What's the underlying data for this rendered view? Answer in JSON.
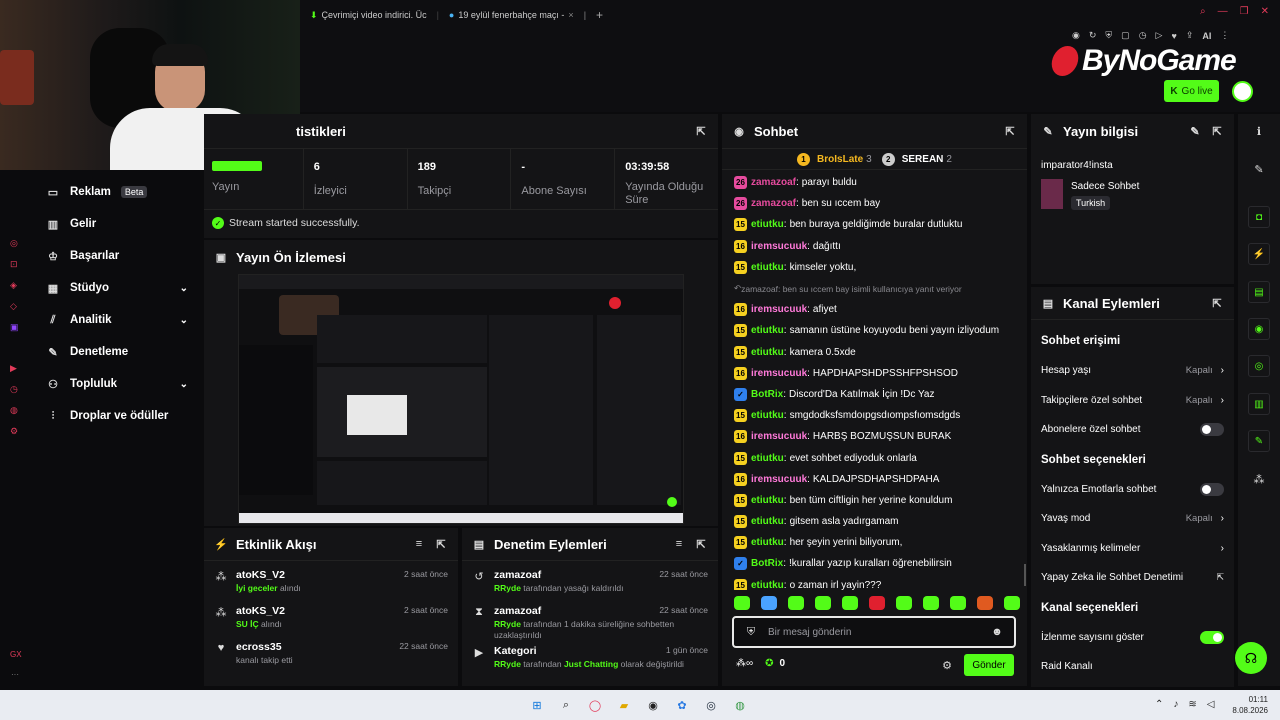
{
  "browser": {
    "tabs": [
      {
        "label": "Çevrimiçi video indirici. Üc"
      },
      {
        "label": "19 eylül fenerbahçe maçı -"
      }
    ],
    "new_tab": "+",
    "ai_label": "AI"
  },
  "brand": {
    "logo_text": "ByNoGame",
    "go_live": "Go live"
  },
  "stats": {
    "title": "Yayın İstatistikleri",
    "visible_title": "tistikleri",
    "cells": [
      {
        "value": "",
        "label": "Yayın"
      },
      {
        "value": "6",
        "label": "İzleyici"
      },
      {
        "value": "189",
        "label": "Takipçi"
      },
      {
        "value": "-",
        "label": "Abone Sayısı"
      },
      {
        "value": "03:39:58",
        "label": "Yayında Olduğu Süre"
      }
    ],
    "success": "Stream started successfully."
  },
  "preview": {
    "title": "Yayın Ön İzlemesi"
  },
  "sidebar": {
    "items": [
      {
        "label": "Reklam",
        "badge": "Beta",
        "icon": "tv-icon"
      },
      {
        "label": "Gelir",
        "icon": "chart-icon"
      },
      {
        "label": "Başarılar",
        "icon": "trophy-icon"
      },
      {
        "label": "Stüdyo",
        "icon": "studio-icon",
        "chevron": true
      },
      {
        "label": "Analitik",
        "icon": "analytics-icon",
        "chevron": true
      },
      {
        "label": "Denetleme",
        "icon": "wrench-icon"
      },
      {
        "label": "Topluluk",
        "icon": "community-icon",
        "chevron": true
      },
      {
        "label": "Droplar ve ödüller",
        "icon": "drop-icon"
      }
    ]
  },
  "activity": {
    "title": "Etkinlik Akışı",
    "items": [
      {
        "user": "atoKS_V2",
        "time": "2 saat önce",
        "item": "İyi geceler",
        "suffix": " alındı"
      },
      {
        "user": "atoKS_V2",
        "time": "2 saat önce",
        "item": "SU İÇ",
        "suffix": " alındı"
      },
      {
        "user": "ecross35",
        "time": "22 saat önce",
        "item": "",
        "suffix": "kanalı takip etti"
      }
    ]
  },
  "moderation": {
    "title": "Denetim Eylemleri",
    "items": [
      {
        "user": "zamazoaf",
        "time": "22 saat önce",
        "actor": "RRyde",
        "text": " tarafından yasağı kaldırıldı"
      },
      {
        "user": "zamazoaf",
        "time": "22 saat önce",
        "actor": "RRyde",
        "text": " tarafından 1 dakika süreliğine sohbetten uzaklaştırıldı"
      },
      {
        "user": "Kategori",
        "time": "1 gün önce",
        "actor": "RRyde",
        "text": " tarafından ",
        "highlight": "Just Chatting",
        "tail": " olarak değiştirildi"
      }
    ]
  },
  "chat": {
    "title": "Sohbet",
    "leaders": [
      {
        "rank": "1",
        "name": "BroIsLate",
        "count": "3"
      },
      {
        "rank": "2",
        "name": "SEREAN",
        "count": "2"
      }
    ],
    "messages": [
      {
        "badge": "26",
        "badge_color": "#e64b9e",
        "user": "zamazoaf",
        "user_color": "#e64b9e",
        "text": "parayı buldu"
      },
      {
        "badge": "26",
        "badge_color": "#e64b9e",
        "user": "zamazoaf",
        "user_color": "#e64b9e",
        "text": "ben su ıccem bay"
      },
      {
        "badge": "15",
        "badge_color": "#f5d020",
        "user": "etiutku",
        "user_color": "#53fc18",
        "text": "ben buraya geldiğimde buralar dutluktu"
      },
      {
        "badge": "16",
        "badge_color": "#f5d020",
        "user": "iremsucuuk",
        "user_color": "#ff7ad9",
        "text": "dağıttı"
      },
      {
        "badge": "15",
        "badge_color": "#f5d020",
        "user": "etiutku",
        "user_color": "#53fc18",
        "text": "kimseler yoktu,"
      },
      {
        "reply": "zamazoaf: ben su ıccem bay isimli kullanıcıya yanıt veriyor"
      },
      {
        "badge": "16",
        "badge_color": "#f5d020",
        "user": "iremsucuuk",
        "user_color": "#ff7ad9",
        "text": "afiyet"
      },
      {
        "badge": "15",
        "badge_color": "#f5d020",
        "user": "etiutku",
        "user_color": "#53fc18",
        "text": "samanın üstüne koyuyodu beni yayın izliyodum"
      },
      {
        "badge": "15",
        "badge_color": "#f5d020",
        "user": "etiutku",
        "user_color": "#53fc18",
        "text": "kamera 0.5xde"
      },
      {
        "badge": "16",
        "badge_color": "#f5d020",
        "user": "iremsucuuk",
        "user_color": "#ff7ad9",
        "text": "HAPDHAPSHDPSSHFPSHSOD"
      },
      {
        "badge": "✓",
        "badge_color": "#2f80ed",
        "user": "BotRix",
        "user_color": "#53fc18",
        "text": "Discord'Da Katılmak İçin !Dc Yaz"
      },
      {
        "badge": "15",
        "badge_color": "#f5d020",
        "user": "etiutku",
        "user_color": "#53fc18",
        "text": "smgdodksfsmdoıpgsdıompsfıomsdgds"
      },
      {
        "badge": "16",
        "badge_color": "#f5d020",
        "user": "iremsucuuk",
        "user_color": "#ff7ad9",
        "text": "HARBŞ BOZMUŞSUN BURAK"
      },
      {
        "badge": "15",
        "badge_color": "#f5d020",
        "user": "etiutku",
        "user_color": "#53fc18",
        "text": "evet sohbet ediyoduk onlarla"
      },
      {
        "badge": "16",
        "badge_color": "#f5d020",
        "user": "iremsucuuk",
        "user_color": "#ff7ad9",
        "text": "KALDAJPSDHAPSHDPAHA"
      },
      {
        "badge": "15",
        "badge_color": "#f5d020",
        "user": "etiutku",
        "user_color": "#53fc18",
        "text": "ben tüm ciftligin her yerine konuldum"
      },
      {
        "badge": "15",
        "badge_color": "#f5d020",
        "user": "etiutku",
        "user_color": "#53fc18",
        "text": "gitsem asla yadırgamam"
      },
      {
        "badge": "15",
        "badge_color": "#f5d020",
        "user": "etiutku",
        "user_color": "#53fc18",
        "text": "her şeyin yerini biliyorum,"
      },
      {
        "badge": "✓",
        "badge_color": "#2f80ed",
        "user": "BotRix",
        "user_color": "#53fc18",
        "text": "!kurallar yazıp kuralları öğrenebilirsin"
      },
      {
        "badge": "15",
        "badge_color": "#f5d020",
        "user": "etiutku",
        "user_color": "#53fc18",
        "text": "o zaman irl yayin???"
      }
    ],
    "input_placeholder": "Bir mesaj gönderin",
    "points_value": "0",
    "send_label": "Gönder"
  },
  "stream_info": {
    "title": "Yayın bilgisi",
    "stream_title": "imparator4!insta",
    "category": "Sadece Sohbet",
    "tag": "Turkish"
  },
  "channel_actions": {
    "title": "Kanal Eylemleri",
    "chat_access": "Sohbet erişimi",
    "account_age": {
      "label": "Hesap yaşı",
      "value": "Kapalı"
    },
    "followers_only": {
      "label": "Takipçilere özel sohbet",
      "value": "Kapalı"
    },
    "subscribers_only": {
      "label": "Abonelere özel sohbet"
    },
    "chat_options": "Sohbet seçenekleri",
    "emotes_only": {
      "label": "Yalnızca Emotlarla sohbet"
    },
    "slow_mode": {
      "label": "Yavaş mod",
      "value": "Kapalı"
    },
    "banned_words": {
      "label": "Yasaklanmış kelimeler"
    },
    "ai_moderation": {
      "label": "Yapay Zeka ile Sohbet Denetimi"
    },
    "channel_options": "Kanal seçenekleri",
    "show_viewers": {
      "label": "İzlenme sayısını göster"
    },
    "raid": {
      "label": "Raid Kanalı"
    }
  },
  "taskbar": {
    "time": "01:11",
    "date": "8.08.2026"
  },
  "left_rail": {
    "label": "GX"
  }
}
